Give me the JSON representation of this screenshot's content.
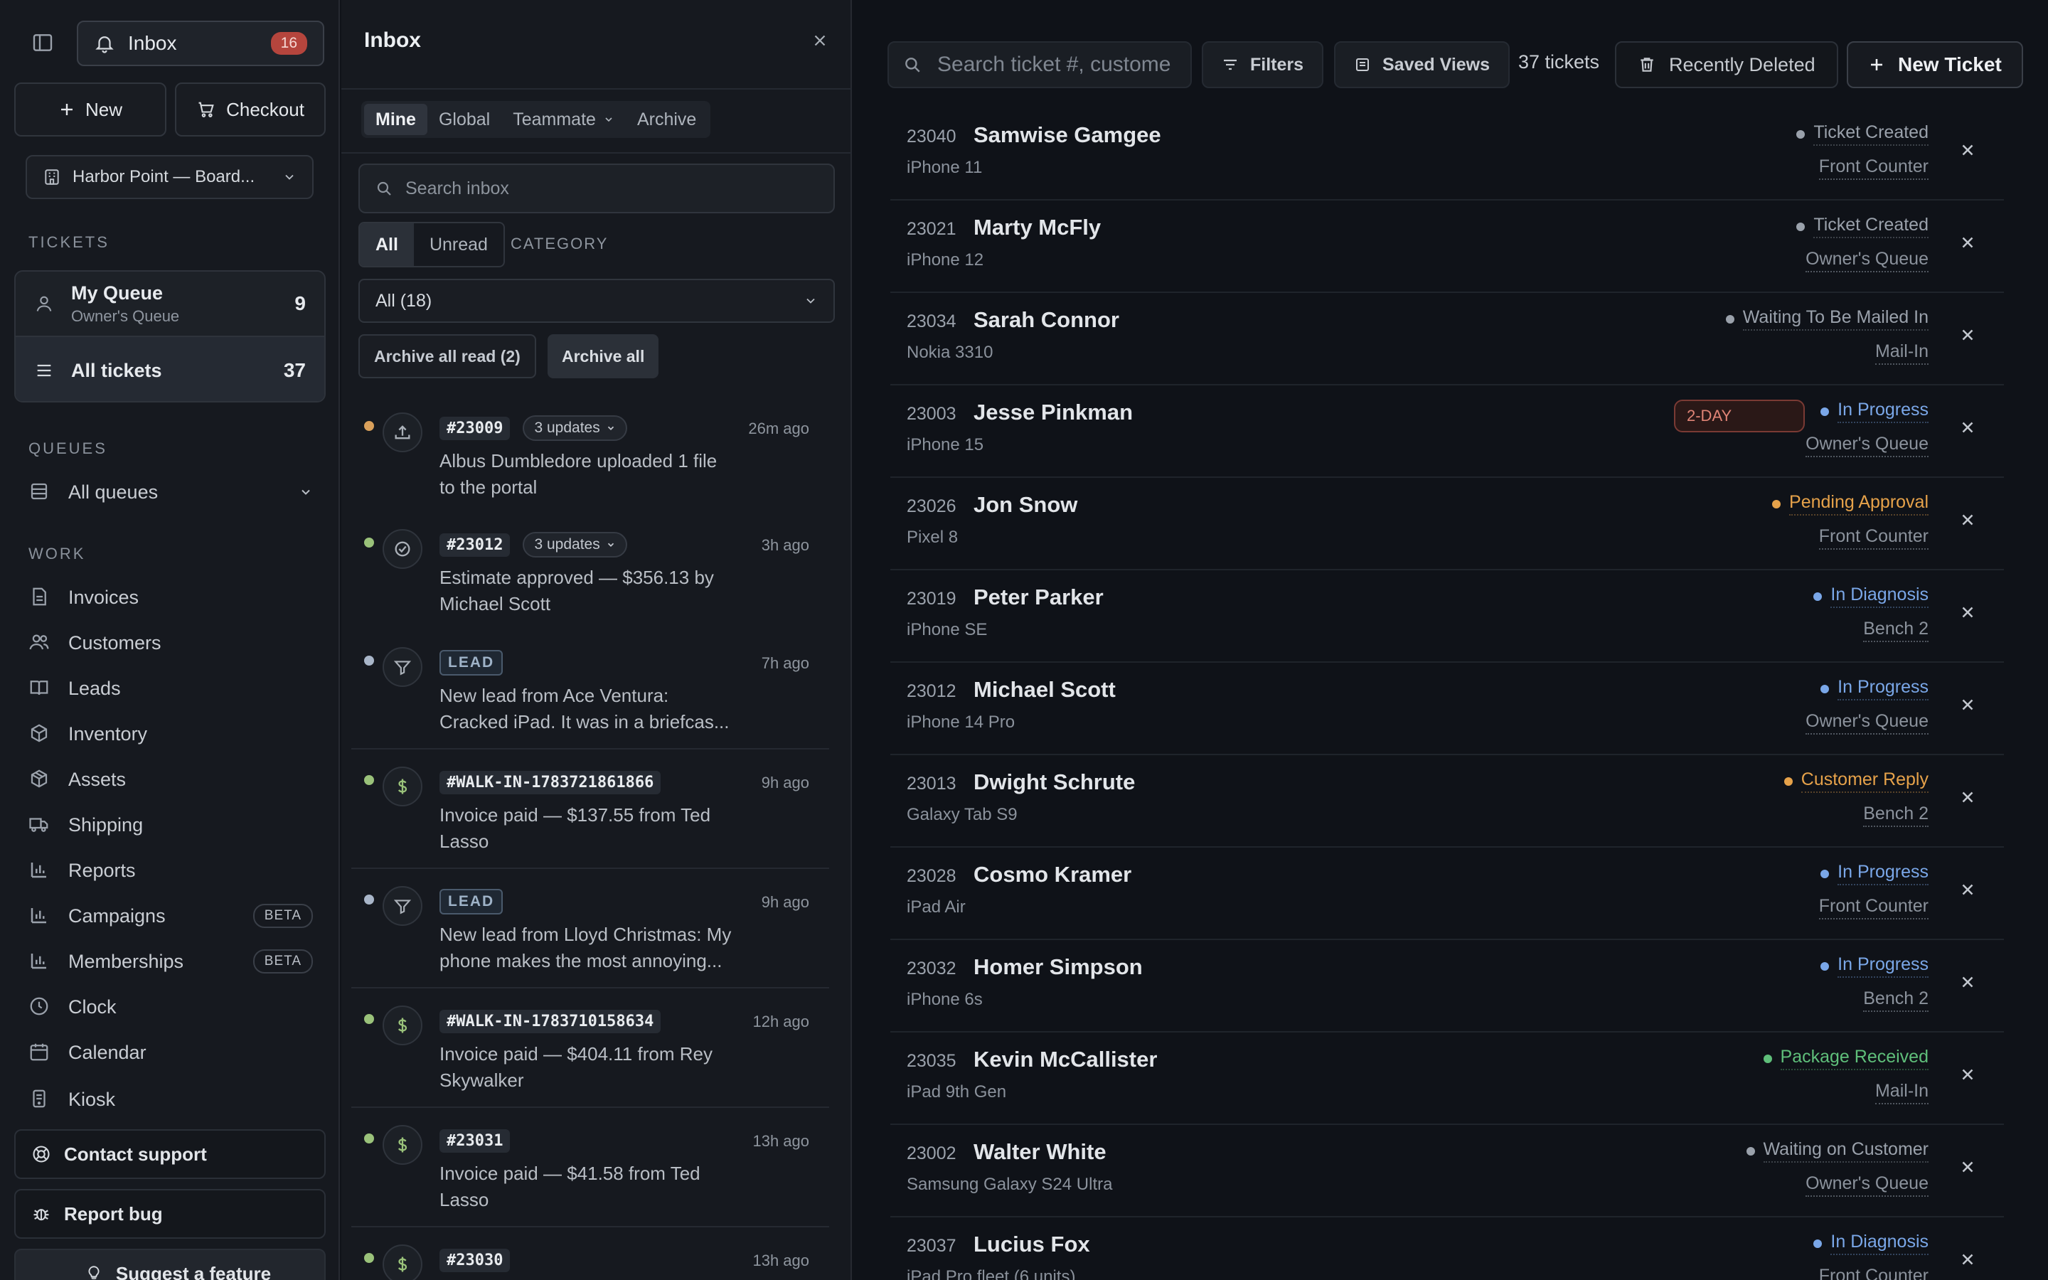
{
  "sidebar": {
    "inbox_label": "Inbox",
    "inbox_badge": "16",
    "new_label": "New",
    "checkout_label": "Checkout",
    "location": "Harbor Point — Board...",
    "tickets_section": "TICKETS",
    "my_queue": {
      "title": "My Queue",
      "sub": "Owner's Queue",
      "count": "9"
    },
    "all_tickets": {
      "title": "All tickets",
      "count": "37"
    },
    "queues_section": "QUEUES",
    "all_queues": "All queues",
    "work_section": "WORK",
    "nav": [
      {
        "label": "Invoices",
        "icon": "file-icon"
      },
      {
        "label": "Customers",
        "icon": "users-icon"
      },
      {
        "label": "Leads",
        "icon": "book-icon"
      },
      {
        "label": "Inventory",
        "icon": "box-icon"
      },
      {
        "label": "Assets",
        "icon": "cube-icon"
      },
      {
        "label": "Shipping",
        "icon": "truck-icon"
      },
      {
        "label": "Reports",
        "icon": "bar-chart-icon"
      },
      {
        "label": "Campaigns",
        "icon": "bar-chart-icon",
        "badge": "BETA"
      },
      {
        "label": "Memberships",
        "icon": "bar-chart-icon",
        "badge": "BETA"
      },
      {
        "label": "Clock",
        "icon": "clock-icon"
      },
      {
        "label": "Calendar",
        "icon": "calendar-icon"
      },
      {
        "label": "Kiosk",
        "icon": "tablet-icon"
      }
    ],
    "contact_support": "Contact support",
    "report_bug": "Report bug",
    "suggest_feature": "Suggest a feature"
  },
  "inbox": {
    "title": "Inbox",
    "tabs": [
      "Mine",
      "Global",
      "Teammate",
      "Archive"
    ],
    "search_placeholder": "Search inbox",
    "filter_all": "All",
    "filter_unread": "Unread",
    "category_label": "CATEGORY",
    "category_value": "All (18)",
    "archive_read": "Archive all read (2)",
    "archive_all": "Archive all",
    "items": [
      {
        "dot": "#d9a05b",
        "icon": "upload-icon",
        "tag": "#23009",
        "tag_type": "ticket",
        "updates": "3 updates",
        "time": "26m ago",
        "line1": "Albus Dumbledore uploaded 1 file",
        "line2": "to the portal"
      },
      {
        "dot": "#9ac27a",
        "icon": "check-circle-icon",
        "tag": "#23012",
        "tag_type": "ticket",
        "updates": "3 updates",
        "time": "3h ago",
        "line1": "Estimate approved — $356.13 by",
        "line2": "Michael Scott"
      },
      {
        "dot": "#a9b6c9",
        "icon": "funnel-icon",
        "tag": "LEAD",
        "tag_type": "lead",
        "updates": "",
        "time": "7h ago",
        "line1": "New lead from Ace Ventura:",
        "line2": "Cracked iPad. It was in a briefcas..."
      },
      {
        "dot": "#9ac27a",
        "icon": "dollar-icon",
        "tag": "#WALK-IN-1783721861866",
        "tag_type": "ticket",
        "updates": "",
        "time": "9h ago",
        "line1": "Invoice paid — $137.55 from Ted",
        "line2": "Lasso"
      },
      {
        "dot": "#a9b6c9",
        "icon": "funnel-icon",
        "tag": "LEAD",
        "tag_type": "lead",
        "updates": "",
        "time": "9h ago",
        "line1": "New lead from Lloyd Christmas: My",
        "line2": "phone makes the most annoying..."
      },
      {
        "dot": "#9ac27a",
        "icon": "dollar-icon",
        "tag": "#WALK-IN-1783710158634",
        "tag_type": "ticket",
        "updates": "",
        "time": "12h ago",
        "line1": "Invoice paid — $404.11 from Rey",
        "line2": "Skywalker"
      },
      {
        "dot": "#9ac27a",
        "icon": "dollar-icon",
        "tag": "#23031",
        "tag_type": "ticket",
        "updates": "",
        "time": "13h ago",
        "line1": "Invoice paid — $41.58 from Ted",
        "line2": "Lasso"
      },
      {
        "dot": "#9ac27a",
        "icon": "dollar-icon",
        "tag": "#23030",
        "tag_type": "ticket",
        "updates": "",
        "time": "13h ago",
        "line1": "",
        "line2": ""
      }
    ]
  },
  "tickets": {
    "search_placeholder": "Search ticket #, custome",
    "filters": "Filters",
    "saved_views": "Saved Views",
    "count": "37 tickets",
    "recently_deleted": "Recently Deleted",
    "new_ticket": "New Ticket",
    "rows": [
      {
        "num": "23040",
        "name": "Samwise Gamgee",
        "device": "iPhone 11",
        "status": "Ticket Created",
        "status_color": "#9aa1ab",
        "location": "Front Counter",
        "pill": ""
      },
      {
        "num": "23021",
        "name": "Marty McFly",
        "device": "iPhone 12",
        "status": "Ticket Created",
        "status_color": "#9aa1ab",
        "location": "Owner's Queue",
        "pill": ""
      },
      {
        "num": "23034",
        "name": "Sarah Connor",
        "device": "Nokia 3310",
        "status": "Waiting To Be Mailed In",
        "status_color": "#9aa1ab",
        "location": "Mail-In",
        "pill": ""
      },
      {
        "num": "23003",
        "name": "Jesse Pinkman",
        "device": "iPhone 15",
        "status": "In Progress",
        "status_color": "#7aa7e8",
        "location": "Owner's Queue",
        "pill": "2-DAY"
      },
      {
        "num": "23026",
        "name": "Jon Snow",
        "device": "Pixel 8",
        "status": "Pending Approval",
        "status_color": "#e6a24a",
        "location": "Front Counter",
        "pill": ""
      },
      {
        "num": "23019",
        "name": "Peter Parker",
        "device": "iPhone SE",
        "status": "In Diagnosis",
        "status_color": "#7aa7e8",
        "location": "Bench 2",
        "pill": ""
      },
      {
        "num": "23012",
        "name": "Michael Scott",
        "device": "iPhone 14 Pro",
        "status": "In Progress",
        "status_color": "#7aa7e8",
        "location": "Owner's Queue",
        "pill": ""
      },
      {
        "num": "23013",
        "name": "Dwight Schrute",
        "device": "Galaxy Tab S9",
        "status": "Customer Reply",
        "status_color": "#e6a24a",
        "location": "Bench 2",
        "pill": ""
      },
      {
        "num": "23028",
        "name": "Cosmo Kramer",
        "device": "iPad Air",
        "status": "In Progress",
        "status_color": "#7aa7e8",
        "location": "Front Counter",
        "pill": ""
      },
      {
        "num": "23032",
        "name": "Homer Simpson",
        "device": "iPhone 6s",
        "status": "In Progress",
        "status_color": "#7aa7e8",
        "location": "Bench 2",
        "pill": ""
      },
      {
        "num": "23035",
        "name": "Kevin McCallister",
        "device": "iPad 9th Gen",
        "status": "Package Received",
        "status_color": "#5fbf7a",
        "location": "Mail-In",
        "pill": ""
      },
      {
        "num": "23002",
        "name": "Walter White",
        "device": "Samsung Galaxy S24 Ultra",
        "status": "Waiting on Customer",
        "status_color": "#9aa1ab",
        "location": "Owner's Queue",
        "pill": ""
      },
      {
        "num": "23037",
        "name": "Lucius Fox",
        "device": "iPad Pro fleet (6 units)",
        "status": "In Diagnosis",
        "status_color": "#7aa7e8",
        "location": "Front Counter",
        "pill": ""
      }
    ]
  }
}
